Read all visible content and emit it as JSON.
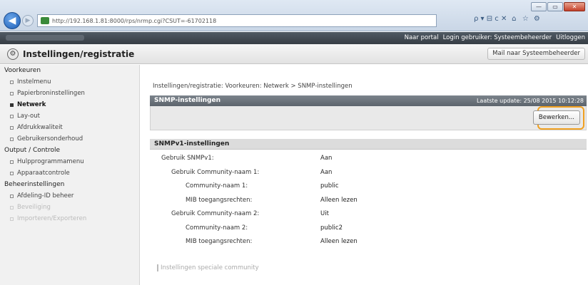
{
  "browser": {
    "url": "http://192.168.1.81:8000/rps/nrmp.cgi?CSUT=-61702118",
    "search_toolbar": "ρ ▾ ⊟ c ✕",
    "home_icon": "⌂",
    "star_icon": "☆",
    "gear_icon": "⚙",
    "win_min": "—",
    "win_max": "▭",
    "win_close": "✕",
    "back": "◀",
    "forward": "▶"
  },
  "topstrip": {
    "portal": "Naar portal",
    "login_label": "Login gebruiker: Systeembeheerder",
    "logout": "Uitloggen"
  },
  "titlebar": {
    "title": "Instellingen/registratie",
    "mail_button": "Mail naar Systeembeheerder"
  },
  "sidebar": {
    "sections": [
      {
        "label": "Voorkeuren",
        "items": [
          {
            "label": "Instelmenu"
          },
          {
            "label": "Papierbroninstellingen"
          },
          {
            "label": "Netwerk"
          },
          {
            "label": "Lay-out"
          },
          {
            "label": "Afdrukkwaliteit"
          },
          {
            "label": "Gebruikersonderhoud"
          }
        ]
      },
      {
        "label": "Output / Controle",
        "items": [
          {
            "label": "Hulpprogrammamenu"
          },
          {
            "label": "Apparaatcontrole"
          }
        ]
      },
      {
        "label": "Beheerinstellingen",
        "items": [
          {
            "label": "Afdeling-ID beheer"
          },
          {
            "label": "Beveiliging"
          },
          {
            "label": "Importeren/Exporteren"
          }
        ]
      }
    ]
  },
  "main": {
    "breadcrumb": "Instellingen/registratie: Voorkeuren: Netwerk > SNMP-instellingen",
    "panel_title": "SNMP-instellingen",
    "last_update": "Laatste update: 25/08 2015 10:12:28",
    "edit_button": "Bewerken...",
    "section_title": "SNMPv1-instellingen",
    "rows": [
      {
        "label": "Gebruik SNMPv1:",
        "value": "Aan",
        "level": 0
      },
      {
        "label": "Gebruik Community-naam 1:",
        "value": "Aan",
        "level": 1
      },
      {
        "label": "Community-naam 1:",
        "value": "public",
        "level": 2
      },
      {
        "label": "MIB toegangsrechten:",
        "value": "Alleen lezen",
        "level": 2
      },
      {
        "label": "Gebruik Community-naam 2:",
        "value": "Uit",
        "level": 1
      },
      {
        "label": "Community-naam 2:",
        "value": "public2",
        "level": 2
      },
      {
        "label": "MIB toegangsrechten:",
        "value": "Alleen lezen",
        "level": 2
      }
    ],
    "subsection": "Instellingen speciale community"
  },
  "colors": {
    "highlight": "#f0a020",
    "panel_header": "#5c646c",
    "topstrip": "#363d44"
  }
}
